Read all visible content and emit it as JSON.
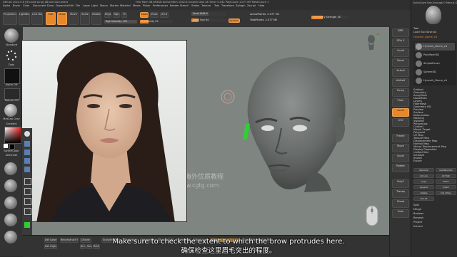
{
  "app": {
    "title": "ZBrush 2022.0.6 [Hyunsik Jung]  ZBrush Document",
    "status": "Free Mem 38.693GB  Active Mem 1042.6  Scratch Disk 48  Timer 0.032  PolyCount 1.077 MP  MeshCount 1",
    "right_title": "QuickSave   See-through 0   Menus   DefaultZScript"
  },
  "menu": [
    "Alpha",
    "Brush",
    "Color",
    "Document",
    "Draw",
    "Dynamics",
    "Edit",
    "File",
    "Layer",
    "Light",
    "Macro",
    "Marker",
    "Material",
    "Movie",
    "Picker",
    "Preferences",
    "Render",
    "Stencil",
    "Stroke",
    "Texture",
    "Tool",
    "Transform",
    "Zplugin",
    "Zscript",
    "Help"
  ],
  "top_shelf": {
    "buttons": [
      "Projection Master",
      "LightBox",
      "Live Boolean",
      "Edit",
      "Draw",
      "Move",
      "Scale",
      "Rotate"
    ],
    "mrgb": "Mrgb",
    "rgb": "Rgb",
    "m": "M",
    "zadd": "Zadd",
    "zsub": "Zsub",
    "zcut": "Zcut",
    "focal_shift": "Focal Shift 0",
    "draw_size": "Draw Size 64",
    "dynamic": "Dynamic",
    "rgb_intensity": "Rgb Intensity 100",
    "z_intensity": "Z Intensity 25",
    "active_points": "ActivePoints: 2.077 Mil",
    "total_points": "TotalPoints: 2.077 Mil",
    "symmetry_strength": "Symmetry Strength 18"
  },
  "left_shelf": {
    "brush_label": "Standard",
    "stroke_label": "Dots",
    "alpha_label": "Alpha Off",
    "texture_label": "Texture Off",
    "material_label": "MatCap Gray",
    "gradient": "Gradient",
    "switch_color": "SwitchColor",
    "alternate": "Alternate"
  },
  "viewport": {
    "background_color": "#7f8681",
    "model_color": "#676b69"
  },
  "right_strip": [
    "BPR",
    "SPix 3",
    "Scroll",
    "Zoom",
    "Actual",
    "AAHalf",
    "Persp",
    "Floor",
    "Local",
    "XYZ",
    "Frame",
    "Move",
    "Scale",
    "Rotate",
    "PolyF",
    "Transp",
    "Ghost",
    "Solo"
  ],
  "right_panel": {
    "header": "Tool",
    "subheader": "Load Tool  Save As",
    "tool_name": "Hyunsik_Dome_v4",
    "subtools": [
      "Hyunsik_Dome_v4",
      "PolyMesh3D",
      "SimpleBrush",
      "Sphere3D",
      "Hyunsik_Dome_v4"
    ],
    "items": [
      "Subtool",
      "Geometry",
      "ArrayMesh",
      "NanoMesh",
      "Layers",
      "FiberMesh",
      "Geometry HD",
      "Preview",
      "Surface",
      "Deformation",
      "Masking",
      "Visibility",
      "Polygroups",
      "Contact",
      "Morph Target",
      "Polypaint",
      "UV Map",
      "Texture Map",
      "Displacement Map",
      "Normal Map",
      "Vector Displacement Map",
      "Display Properties",
      "Unified Skin",
      "Initialize",
      "Import",
      "Export"
    ],
    "bottom": [
      "Rename",
      "AutoReorder",
      "All Low",
      "All High",
      "Copy",
      "Paste",
      "Append",
      "Insert",
      "Delete",
      "Del Other",
      "Del All",
      "Split",
      "Merge",
      "Boolean",
      "Remesh",
      "Project",
      "Extract"
    ]
  },
  "bottom_shelf": {
    "items": [
      "Del Lower",
      "Del Higher",
      "Reconstruct Subdiv",
      "Divide",
      "Smt",
      "Suv",
      "ReUV",
      "Sculptris Pro",
      "ZRemesher",
      "Dynamesh",
      "Groups Split",
      "Frame Mesh",
      "Edge Loop"
    ],
    "sdiv": "SDiv 5",
    "lower_res": "Lower Res",
    "higher_res": "Higher Res"
  },
  "watermark": {
    "line1": "更多海外优质教程",
    "line2": "www.cgtg.com"
  },
  "subtitles": {
    "english": "Make sure to check the extent to which the brow protrudes here.",
    "chinese": "确保检查这里眉毛突出的程度。"
  },
  "colors": {
    "accent_orange": "#e9882a",
    "gold": "#b9822f",
    "viewport": "#7f8681"
  }
}
